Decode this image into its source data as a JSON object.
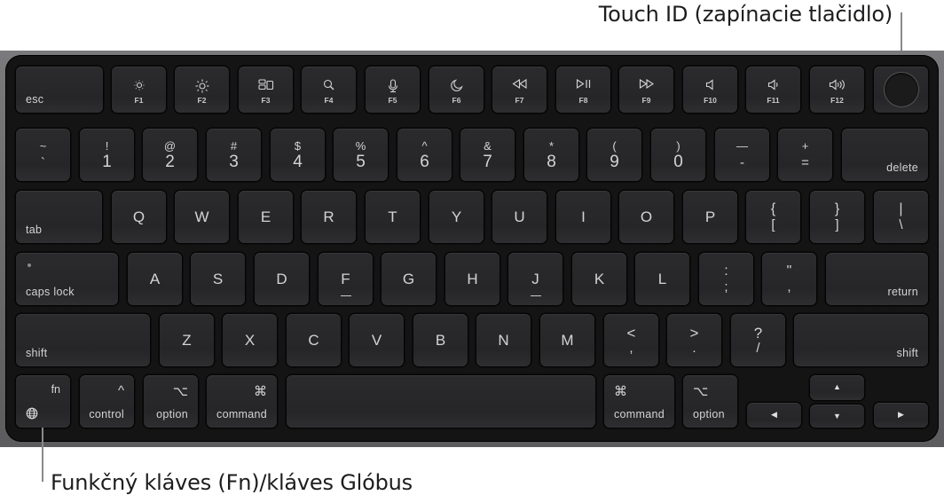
{
  "callouts": {
    "touch_id": "Touch ID (zapínacie tlačidlo)",
    "fn_globe": "Funkčný kláves (Fn)/kláves Glóbus"
  },
  "keyboard": {
    "row_fn": {
      "esc": "esc",
      "fkeys": [
        {
          "label": "F1",
          "icon": "brightness-down-icon"
        },
        {
          "label": "F2",
          "icon": "brightness-up-icon"
        },
        {
          "label": "F3",
          "icon": "mission-control-icon"
        },
        {
          "label": "F4",
          "icon": "spotlight-search-icon"
        },
        {
          "label": "F5",
          "icon": "dictation-microphone-icon"
        },
        {
          "label": "F6",
          "icon": "do-not-disturb-moon-icon"
        },
        {
          "label": "F7",
          "icon": "rewind-icon"
        },
        {
          "label": "F8",
          "icon": "play-pause-icon"
        },
        {
          "label": "F9",
          "icon": "fast-forward-icon"
        },
        {
          "label": "F10",
          "icon": "mute-icon"
        },
        {
          "label": "F11",
          "icon": "volume-down-icon"
        },
        {
          "label": "F12",
          "icon": "volume-up-icon"
        }
      ],
      "touch_id": "touch-id-icon"
    },
    "row_num": {
      "keys": [
        {
          "top": "~",
          "bottom": "`"
        },
        {
          "top": "!",
          "bottom": "1"
        },
        {
          "top": "@",
          "bottom": "2"
        },
        {
          "top": "#",
          "bottom": "3"
        },
        {
          "top": "$",
          "bottom": "4"
        },
        {
          "top": "%",
          "bottom": "5"
        },
        {
          "top": "^",
          "bottom": "6"
        },
        {
          "top": "&",
          "bottom": "7"
        },
        {
          "top": "*",
          "bottom": "8"
        },
        {
          "top": "(",
          "bottom": "9"
        },
        {
          "top": ")",
          "bottom": "0"
        },
        {
          "top": "—",
          "bottom": "-"
        },
        {
          "top": "+",
          "bottom": "="
        }
      ],
      "delete": "delete"
    },
    "row_q": {
      "tab": "tab",
      "letters": [
        "Q",
        "W",
        "E",
        "R",
        "T",
        "Y",
        "U",
        "I",
        "O",
        "P"
      ],
      "symbols": [
        {
          "top": "{",
          "bottom": "["
        },
        {
          "top": "}",
          "bottom": "]"
        },
        {
          "top": "|",
          "bottom": "\\"
        }
      ]
    },
    "row_a": {
      "caps_lock": "caps lock",
      "letters": [
        "A",
        "S",
        "D",
        "F",
        "G",
        "H",
        "J",
        "K",
        "L"
      ],
      "symbols": [
        {
          "top": ":",
          "bottom": ";"
        },
        {
          "top": "\"",
          "bottom": ","
        }
      ],
      "return": "return"
    },
    "row_z": {
      "shift_left": "shift",
      "letters": [
        "Z",
        "X",
        "C",
        "V",
        "B",
        "N",
        "M"
      ],
      "symbols": [
        {
          "top": "<",
          "bottom": ","
        },
        {
          "top": ">",
          "bottom": "."
        },
        {
          "top": "?",
          "bottom": "/"
        }
      ],
      "shift_right": "shift"
    },
    "row_bottom": {
      "fn": "fn",
      "globe_icon": "globe-icon",
      "control": "control",
      "control_symbol": "^",
      "option": "option",
      "option_symbol": "⌥",
      "command": "command",
      "command_symbol": "⌘",
      "arrows": {
        "up": "▲",
        "down": "▼",
        "left": "◀",
        "right": "▶"
      }
    }
  }
}
